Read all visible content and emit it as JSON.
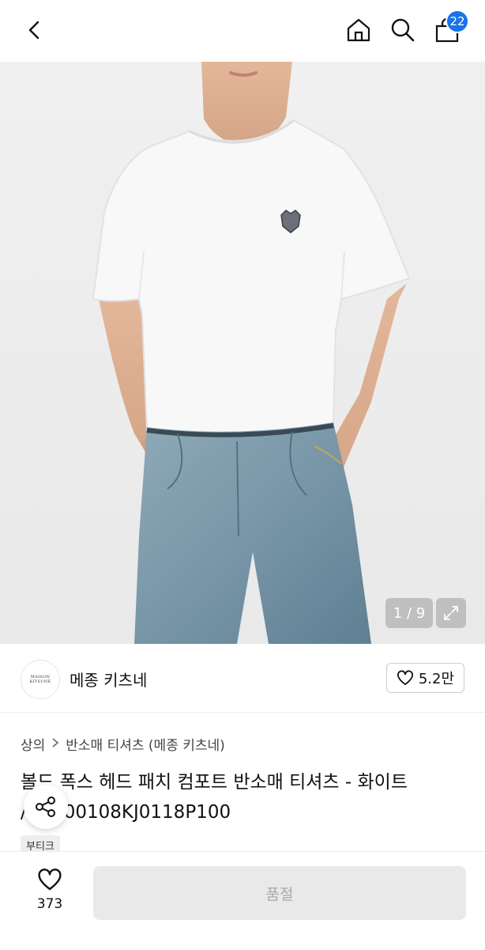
{
  "nav": {
    "back_icon": "chevron-left-icon",
    "home_icon": "home-icon",
    "search_icon": "search-icon",
    "cart_icon": "shopping-bag-icon",
    "cart_count": "22",
    "accent": "#1a73e8"
  },
  "gallery": {
    "counter": "1 / 9",
    "expand_icon": "expand-icon"
  },
  "brand": {
    "logo_text": "MAISON KITSUNÉ",
    "name": "메종 키츠네",
    "likes": "5.2만"
  },
  "breadcrumb": {
    "level1": "상의",
    "level2": "반소매 티셔츠 (메종 키츠네)"
  },
  "product": {
    "title_line1": "볼드 폭스 헤드 패치 컴포트 반소매 티셔츠 - 화이트",
    "title_line2": "/ MM00108KJ0118P100",
    "tag": "부티크"
  },
  "bottom": {
    "wish_count": "373",
    "buy_label": "품절"
  }
}
